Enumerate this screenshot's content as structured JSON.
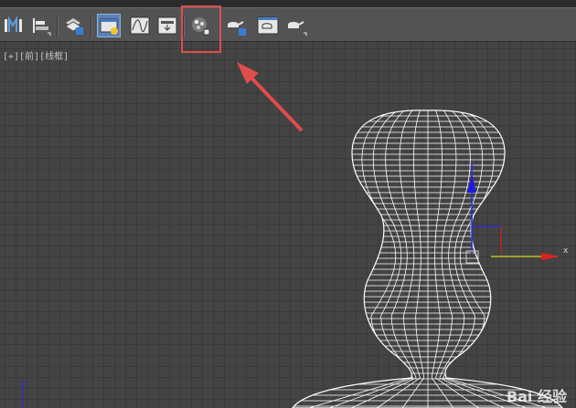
{
  "toolbar": {
    "buttons": [
      {
        "name": "mirror-icon"
      },
      {
        "name": "align-icon"
      },
      {
        "name": "layer-manager-icon"
      },
      {
        "name": "scene-explorer-icon"
      },
      {
        "name": "curve-editor-icon"
      },
      {
        "name": "schematic-view-icon"
      },
      {
        "name": "material-editor-icon",
        "highlighted": true
      },
      {
        "name": "render-setup-icon"
      },
      {
        "name": "rendered-frame-window-icon"
      },
      {
        "name": "render-production-icon"
      }
    ],
    "active_button": "scene-explorer-icon"
  },
  "viewport": {
    "label": "[+][前][线框]",
    "axis_x_label": "x",
    "colors": {
      "grid": "#3a3a3a",
      "wireframe": "#ffffff",
      "axis_x": "#e02020",
      "axis_y": "#2020e0",
      "highlight": "#e14c4c"
    }
  },
  "watermark": {
    "text": "Bai 经验"
  }
}
